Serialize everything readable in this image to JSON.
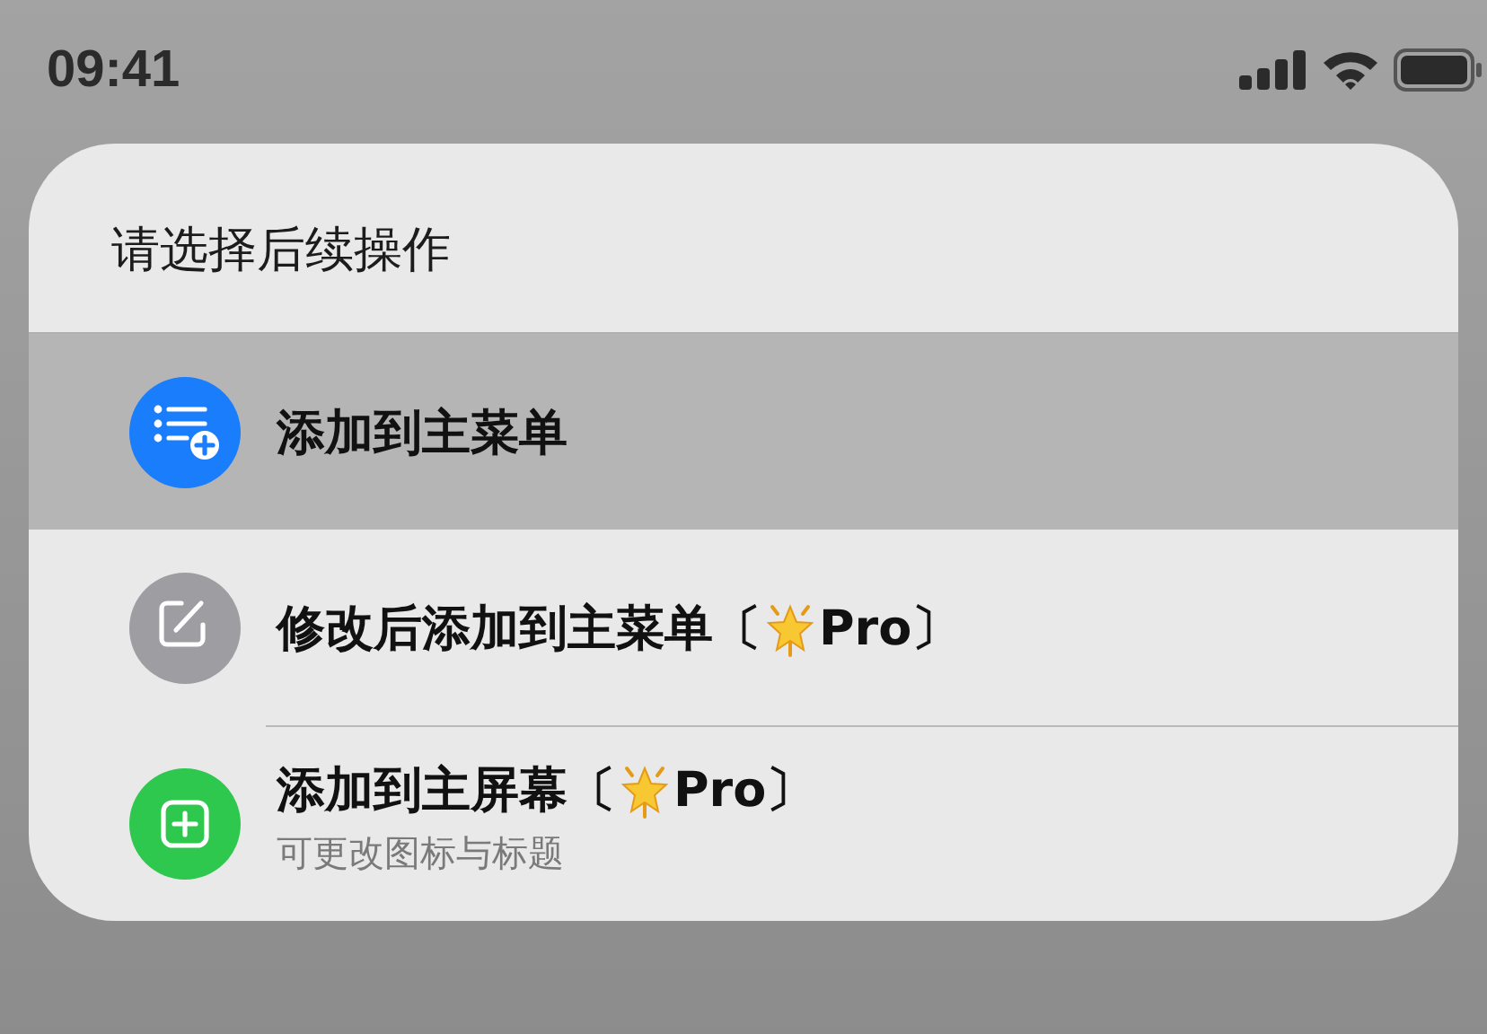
{
  "status_bar": {
    "time": "09:41"
  },
  "sheet": {
    "title": "请选择后续操作",
    "actions": [
      {
        "kind": "list",
        "title": "添加到主菜单",
        "selected": true
      },
      {
        "kind": "edit",
        "title": "修改后添加到主菜单〔",
        "tag": "Pro〕",
        "selected": false
      },
      {
        "kind": "add",
        "title": "添加到主屏幕〔",
        "tag": "Pro〕",
        "subtitle": "可更改图标与标题",
        "selected": false
      }
    ]
  }
}
